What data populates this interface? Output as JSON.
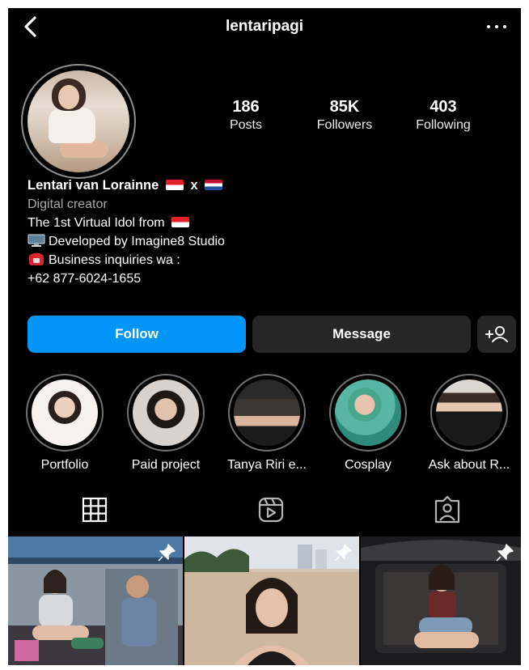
{
  "header": {
    "username": "lentaripagi",
    "back_icon": "chevron-left-icon",
    "more_icon": "more-horizontal-icon"
  },
  "stats": {
    "posts": {
      "value": "186",
      "label": "Posts"
    },
    "followers": {
      "value": "85K",
      "label": "Followers"
    },
    "following": {
      "value": "403",
      "label": "Following"
    }
  },
  "bio": {
    "name": "Lentari van Lorainne",
    "name_separator": "x",
    "category": "Digital creator",
    "line1": "The 1st Virtual Idol from",
    "line2": "Developed by Imagine8 Studio",
    "line3": "Business inquiries wa :",
    "line4": "+62 877-6024-1655"
  },
  "actions": {
    "follow": "Follow",
    "message": "Message",
    "add_user_icon": "add-user-icon"
  },
  "highlights": [
    {
      "label": "Portfolio"
    },
    {
      "label": "Paid project"
    },
    {
      "label": "Tanya Riri e..."
    },
    {
      "label": "Cosplay"
    },
    {
      "label": "Ask about R..."
    }
  ],
  "tabs": [
    {
      "icon": "grid-icon",
      "active": true
    },
    {
      "icon": "reels-icon",
      "active": false
    },
    {
      "icon": "tagged-icon",
      "active": false
    }
  ],
  "colors": {
    "background": "#000000",
    "accent": "#0095f6",
    "secondary_button": "#262626",
    "muted_text": "#a8a8a8"
  }
}
